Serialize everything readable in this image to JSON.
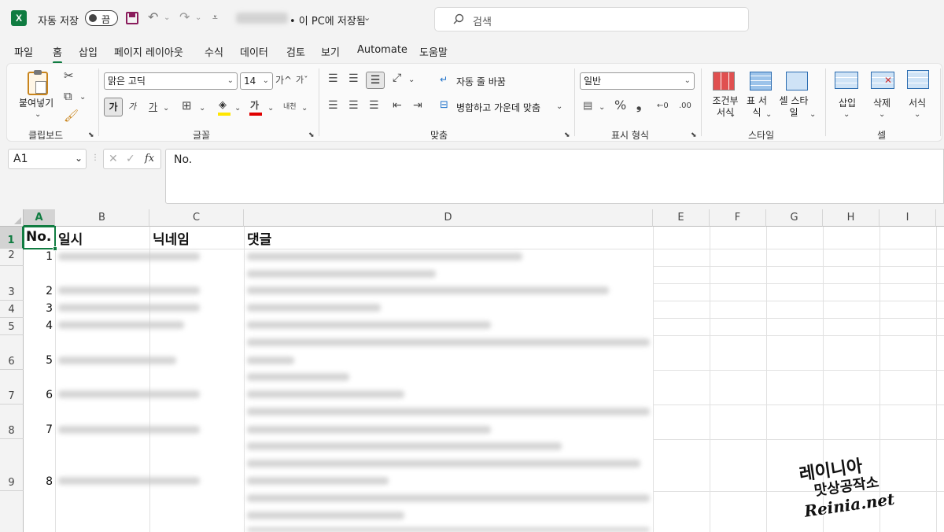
{
  "titlebar": {
    "autosave_label": "자동 저장",
    "autosave_toggle": "끔",
    "save_status": "• 이 PC에 저장됨",
    "search_placeholder": "검색"
  },
  "tabs": [
    "파일",
    "홈",
    "삽입",
    "페이지 레이아웃",
    "수식",
    "데이터",
    "검토",
    "보기",
    "Automate",
    "도움말"
  ],
  "ribbon": {
    "clipboard": {
      "paste": "붙여넣기",
      "group": "클립보드"
    },
    "font": {
      "name": "맑은 고딕",
      "size": "14",
      "grow": "가^",
      "shrink": "가ˇ",
      "bold": "가",
      "italic": "가",
      "underline": "가",
      "fontcolor": "가",
      "phonetic": "내천",
      "group": "글꼴"
    },
    "alignment": {
      "wrap": "자동 줄 바꿈",
      "merge": "병합하고 가운데 맞춤",
      "group": "맞춤"
    },
    "number": {
      "format": "일반",
      "percent": "%",
      "comma": "❟",
      "group": "표시 형식"
    },
    "styles": {
      "conditional": "조건부 서식",
      "table": "표 서식",
      "cell": "셀 스타일",
      "group": "스타일"
    },
    "cells": {
      "insert": "삽입",
      "delete": "삭제",
      "format": "서식",
      "group": "셀"
    }
  },
  "formula_bar": {
    "name_box": "A1",
    "fx": "fx",
    "content": "No."
  },
  "columns": [
    "A",
    "B",
    "C",
    "D",
    "E",
    "F",
    "G",
    "H",
    "I"
  ],
  "rows": [
    "1",
    "2",
    "3",
    "4",
    "5",
    "6",
    "7",
    "8",
    "9"
  ],
  "header_row": {
    "a": "No.",
    "b": "일시",
    "c": "닉네임",
    "d": "댓글"
  },
  "row_numbers": [
    "1",
    "2",
    "3",
    "4",
    "5",
    "6",
    "7",
    "8"
  ],
  "watermark": {
    "line1": "레이니아",
    "line2": "맛상공작소",
    "line3": "Reinia.net"
  }
}
